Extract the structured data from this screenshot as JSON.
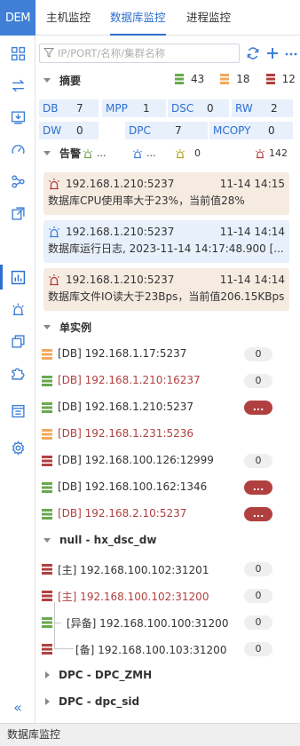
{
  "app": {
    "logo": "DEM"
  },
  "top_tabs": [
    {
      "label": "主机监控",
      "active": false
    },
    {
      "label": "数据库监控",
      "active": true
    },
    {
      "label": "进程监控",
      "active": false
    }
  ],
  "rail_icons": [
    "apps-icon",
    "exchange-icon",
    "monitor-download-icon",
    "dashboard-gauge-icon",
    "topology-icon",
    "export-icon",
    "bar-chart-icon",
    "alarm-siren-icon",
    "copy-icon",
    "puzzle-icon",
    "calendar-report-icon",
    "settings-gear-icon"
  ],
  "search": {
    "placeholder": "IP/PORT/名称/集群名称",
    "value": ""
  },
  "summary": {
    "title": "摘要",
    "green_count": "43",
    "orange_count": "18",
    "red_count": "12",
    "colors": {
      "green": "#6aa84f",
      "orange": "#f3a85a",
      "red": "#b0403f"
    }
  },
  "stats": [
    {
      "label": "DB",
      "value": "7"
    },
    {
      "label": "MPP",
      "value": "1"
    },
    {
      "label": "DSC",
      "value": "0"
    },
    {
      "label": "RW",
      "value": "2"
    },
    {
      "label": "DW",
      "value": "0"
    },
    {
      "label": "DPC",
      "value": "7"
    },
    {
      "label": "MCOPY",
      "value": "0"
    }
  ],
  "alerts": {
    "title": "告警",
    "levels": [
      {
        "value": "...",
        "color": "#6aa84f"
      },
      {
        "value": "...",
        "color": "#3f7fd6"
      },
      {
        "value": "0",
        "color": "#b5a21c"
      },
      {
        "value": "142",
        "color": "#b0403f"
      }
    ],
    "cards": [
      {
        "host": "192.168.1.210:5237",
        "time": "11-14 14:15",
        "message": "数据库CPU使用率大于23%，当前值28%",
        "level": "warning",
        "bg": "#f6ebe1",
        "icon_color": "#b0403f"
      },
      {
        "host": "192.168.1.210:5237",
        "time": "11-14 14:14",
        "message": "数据库运行日志, 2023-11-14 14:17:48.900 [...",
        "level": "info",
        "bg": "#e8f0fb",
        "icon_color": "#3f7fd6"
      },
      {
        "host": "192.168.1.210:5237",
        "time": "11-14 14:14",
        "message": "数据库文件IO读大于23Bps，当前值206.15KBps",
        "level": "warning",
        "bg": "#f6ebe1",
        "icon_color": "#b0403f"
      }
    ]
  },
  "single_instances": {
    "title": "单实例",
    "items": [
      {
        "label": "[DB] 192.168.1.17:5237",
        "status": "orange",
        "badge": "0",
        "red_text": false,
        "badge_red": false
      },
      {
        "label": "[DB] 192.168.1.210:16237",
        "status": "green",
        "badge": "0",
        "red_text": true,
        "badge_red": false
      },
      {
        "label": "[DB] 192.168.1.210:5237",
        "status": "green",
        "badge": "...",
        "red_text": false,
        "badge_red": true
      },
      {
        "label": "[DB] 192.168.1.231:5236",
        "status": "orange",
        "badge": "",
        "red_text": true,
        "badge_red": false
      },
      {
        "label": "[DB] 192.168.100.126:12999",
        "status": "red",
        "badge": "0",
        "red_text": false,
        "badge_red": false
      },
      {
        "label": "[DB] 192.168.100.162:1346",
        "status": "green",
        "badge": "...",
        "red_text": false,
        "badge_red": true
      },
      {
        "label": "[DB] 192.168.2.10:5237",
        "status": "green",
        "badge": "...",
        "red_text": true,
        "badge_red": true
      }
    ]
  },
  "cluster_dw": {
    "title": "null - hx_dsc_dw",
    "items": [
      {
        "label": "[主] 192.168.100.102:31201",
        "status": "red",
        "badge": "0",
        "red_text": false,
        "indent": 0
      },
      {
        "label": "[主] 192.168.100.102:31200",
        "status": "red",
        "badge": "0",
        "red_text": true,
        "indent": 0
      },
      {
        "label": "[异备] 192.168.100.100:31200",
        "status": "green",
        "badge": "0",
        "red_text": false,
        "indent": 1
      },
      {
        "label": "[备] 192.168.100.103:31200",
        "status": "red",
        "badge": "0",
        "red_text": false,
        "indent": 1
      }
    ]
  },
  "collapsed_groups": [
    {
      "title": "DPC - DPC_ZMH"
    },
    {
      "title": "DPC - dpc_sid"
    }
  ],
  "footer": {
    "status": "数据库监控",
    "collapse_symbol": "«"
  }
}
